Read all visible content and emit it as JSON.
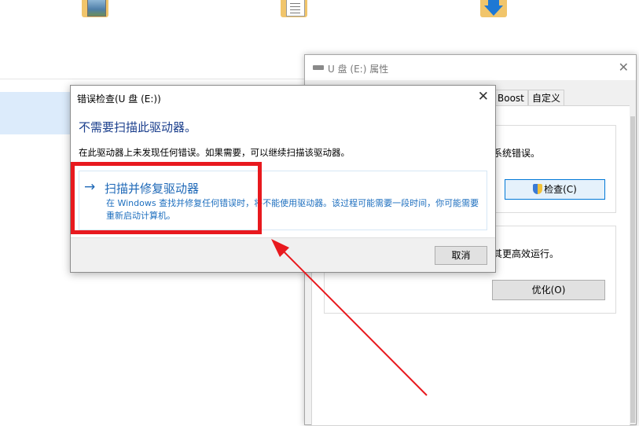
{
  "explorer": {
    "folders": [
      {
        "name": "pictures-folder-icon"
      },
      {
        "name": "documents-folder-icon"
      },
      {
        "name": "downloads-folder-icon"
      }
    ]
  },
  "properties_window": {
    "title": "U 盘 (E:) 属性",
    "tabs": [
      "Boost",
      "自定义"
    ],
    "error_check_text": "系统错误。",
    "check_button": "检查(C)",
    "optimize_text": "其更高效运行。",
    "optimize_button": "优化(O)"
  },
  "dialog": {
    "title": "错误检查(U 盘 (E:))",
    "heading": "不需要扫描此驱动器。",
    "info": "在此驱动器上未发现任何错误。如果需要，可以继续扫描该驱动器。",
    "option_title": "扫描并修复驱动器",
    "option_desc": "在 Windows 查找并修复任何错误时，将不能使用驱动器。该过程可能需要一段时间，你可能需要重新启动计算机。",
    "cancel_button": "取消"
  },
  "colors": {
    "annotation": "#e8191e",
    "link_blue": "#1e68b7",
    "heading_blue": "#1a3e8c"
  }
}
